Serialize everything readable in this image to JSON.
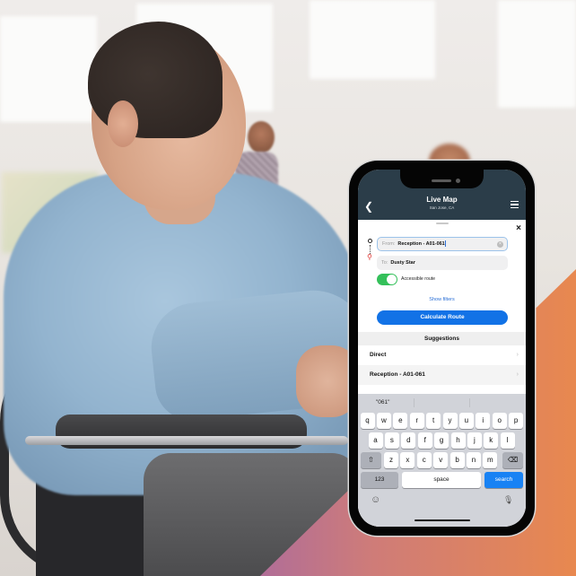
{
  "colors": {
    "nav_bg": "#2b3d49",
    "primary_button": "#1272e6",
    "link": "#2a6fd6",
    "toggle_on": "#34c05a",
    "destination_pin": "#e0342f",
    "keyboard_bg": "#d1d3d9",
    "search_key": "#1882f4",
    "accent_gradient": [
      "#7b55d6",
      "#a166a8",
      "#cf7c78",
      "#e8884f"
    ]
  },
  "nav": {
    "back_icon": "chevron-left",
    "title": "Live Map",
    "subtitle": "San Jose, CA",
    "menu_icon": "hamburger"
  },
  "route_form": {
    "close_icon": "×",
    "from": {
      "label": "From:",
      "value": "Reception - A01-061",
      "clear_icon": "×"
    },
    "to": {
      "label": "To:",
      "value": "Dusty Star"
    },
    "accessible_route": {
      "label": "Accessible route",
      "enabled": true
    },
    "show_filters": "Show filters",
    "calculate_button": "Calculate Route"
  },
  "suggestions": {
    "header": "Suggestions",
    "items": [
      {
        "label": "Direct",
        "chevron": "›"
      },
      {
        "label": "Reception - A01-061",
        "chevron": "›"
      }
    ]
  },
  "keyboard": {
    "prediction": "\"061\"",
    "row1": [
      "q",
      "w",
      "e",
      "r",
      "t",
      "y",
      "u",
      "i",
      "o",
      "p"
    ],
    "row2": [
      "a",
      "s",
      "d",
      "f",
      "g",
      "h",
      "j",
      "k",
      "l"
    ],
    "row3": [
      "z",
      "x",
      "c",
      "v",
      "b",
      "n",
      "m"
    ],
    "shift_icon": "⇧",
    "backspace_icon": "⌫",
    "numbers_key": "123",
    "space_key": "space",
    "search_key": "search",
    "emoji_icon": "☺",
    "mic_icon": "🎙"
  }
}
